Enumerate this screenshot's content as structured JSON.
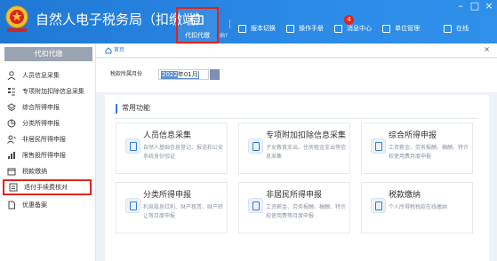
{
  "app": {
    "title": "自然人电子税务局（扣缴端）",
    "window_controls": [
      "–",
      "□",
      "×"
    ]
  },
  "toolbar": {
    "active_label": "代扣代缴",
    "partial_label": "纳?",
    "items": [
      {
        "label": "版本切换",
        "icon": "switch-icon"
      },
      {
        "label": "操作手册",
        "icon": "manual-icon"
      },
      {
        "label": "消息中心",
        "icon": "message-icon",
        "badge": "4"
      },
      {
        "label": "单位管理",
        "icon": "org-icon"
      },
      {
        "label": "在线",
        "icon": "online-service-icon"
      }
    ]
  },
  "sidebar": {
    "header": "代扣代缴",
    "items": [
      {
        "label": "人员信息采集",
        "icon": "person-icon"
      },
      {
        "label": "专项附加扣除信息采集",
        "icon": "list-icon"
      },
      {
        "label": "综合所得申报",
        "icon": "layers-icon"
      },
      {
        "label": "分类所得申报",
        "icon": "pie-icon"
      },
      {
        "label": "非居民所得申报",
        "icon": "person-alt-icon"
      },
      {
        "label": "限售股所得申报",
        "icon": "bar-chart-icon"
      },
      {
        "label": "税款缴纳",
        "icon": "wallet-icon"
      },
      {
        "label": "退付手续费核对",
        "icon": "doc-check-icon",
        "selected": true
      },
      {
        "label": "优惠备案",
        "icon": "file-icon"
      }
    ]
  },
  "breadcrumb": {
    "home": "首页",
    "close": "×"
  },
  "period": {
    "label": "税款所属月份",
    "year": "2022",
    "month": "年01月"
  },
  "section": {
    "title": "常用功能"
  },
  "cards": [
    {
      "title": "人员信息采集",
      "desc": "自然人基础信息登记、报送和公安系统身份验证"
    },
    {
      "title": "专项附加扣除信息采集",
      "desc": "子女教育支出、住房租金支出等信息采集"
    },
    {
      "title": "综合所得申报",
      "desc": "工资薪金、劳务报酬、稿酬、特许权使用费月度申报"
    },
    {
      "title": "分类所得申报",
      "desc": "利息股息红利、财产租赁、财产转让等月度申报"
    },
    {
      "title": "非居民所得申报",
      "desc": "工资薪金、劳务报酬、稿酬、特许权使用费等月度申报"
    },
    {
      "title": "税款缴纳",
      "desc": "个人所得税税款在线缴纳"
    }
  ],
  "colors": {
    "titlebar": "#2b8ae6",
    "highlight": "#e0241c",
    "accent": "#2b7fd8",
    "sidebar_header": "#9aa4b2"
  }
}
